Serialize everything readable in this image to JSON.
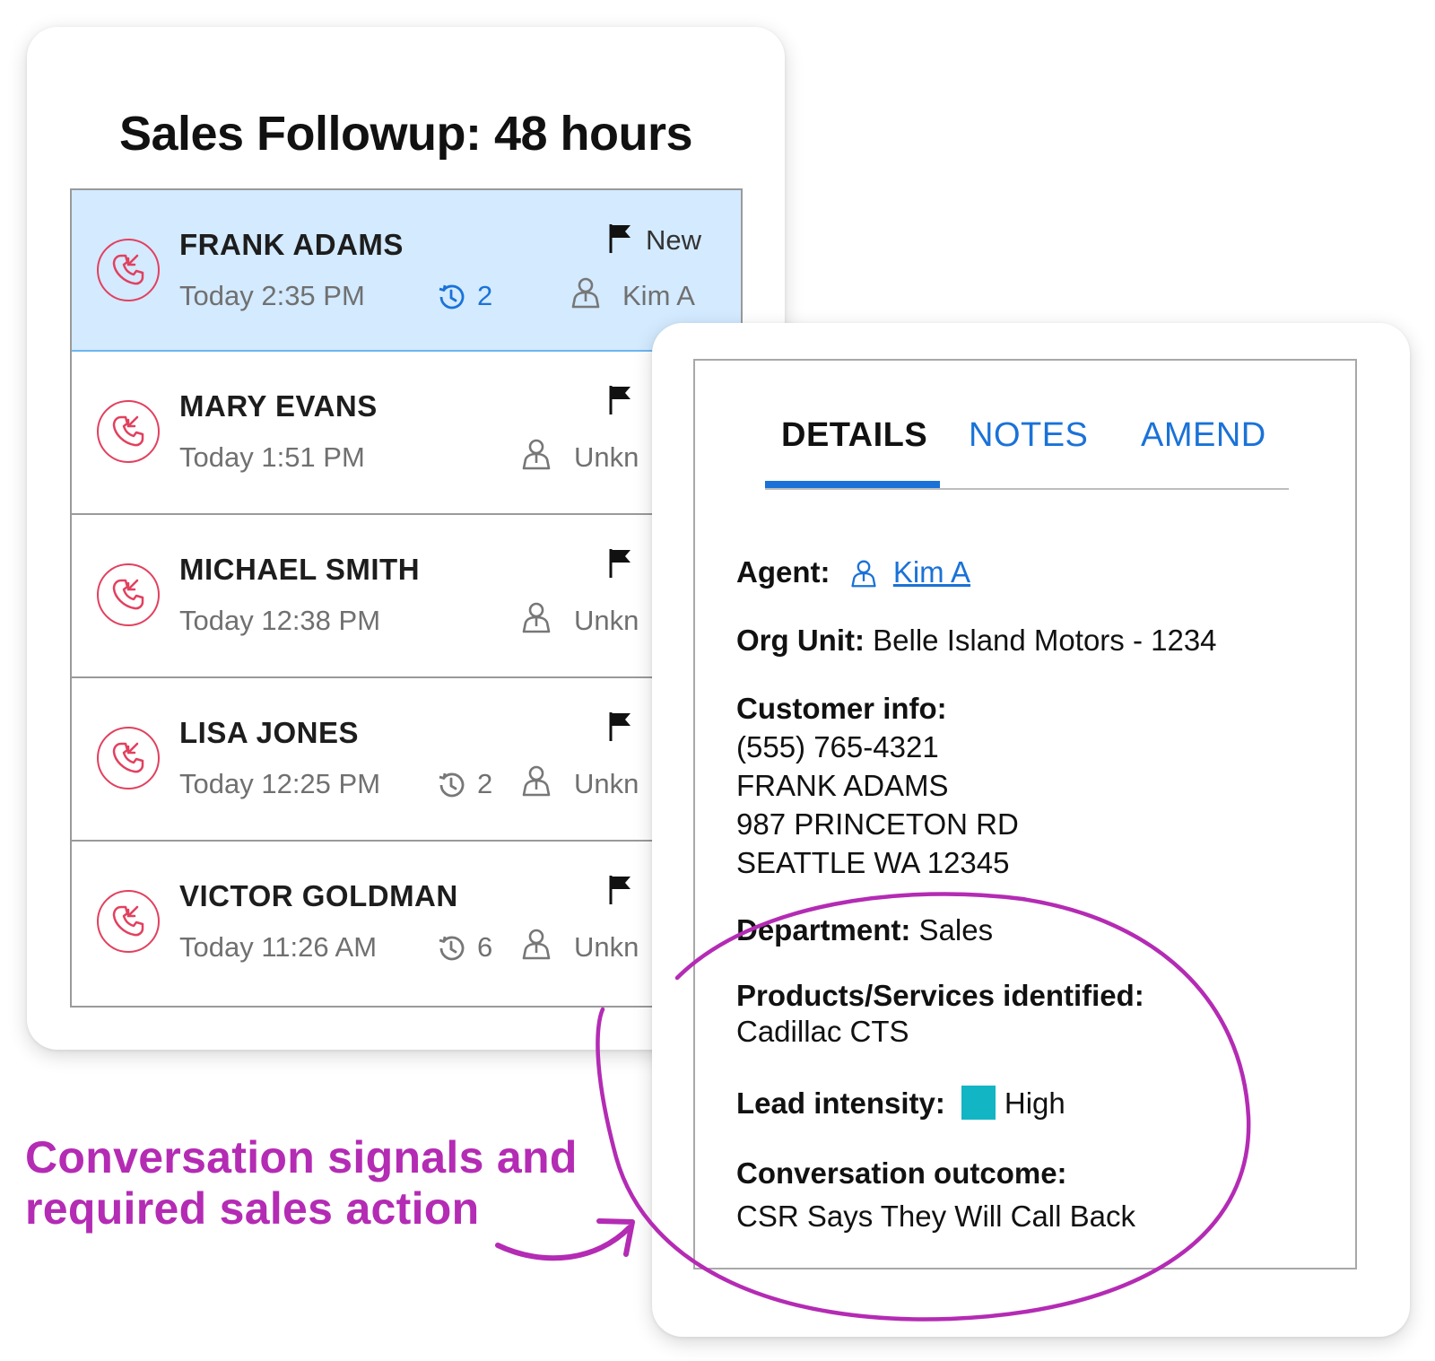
{
  "list": {
    "title": "Sales Followup: 48 hours",
    "rows": [
      {
        "name": "FRANK ADAMS",
        "time": "Today 2:35 PM",
        "status": "New",
        "history": "2",
        "agent": "Kim A"
      },
      {
        "name": "MARY EVANS",
        "time": "Today 1:51 PM",
        "status": "",
        "history": "",
        "agent": "Unkn"
      },
      {
        "name": "MICHAEL SMITH",
        "time": "Today 12:38 PM",
        "status": "",
        "history": "",
        "agent": "Unkn"
      },
      {
        "name": "LISA JONES",
        "time": "Today 12:25 PM",
        "status": "",
        "history": "2",
        "agent": "Unkn"
      },
      {
        "name": "VICTOR GOLDMAN",
        "time": "Today 11:26 AM",
        "status": "",
        "history": "6",
        "agent": "Unkn"
      }
    ]
  },
  "details": {
    "tabs": [
      "DETAILS",
      "NOTES",
      "AMEND"
    ],
    "agent_label": "Agent:",
    "agent_value": "Kim A",
    "org_label": "Org Unit:",
    "org_value": "Belle Island Motors - 1234",
    "customer_label": "Customer info:",
    "customer_lines": [
      "(555) 765-4321",
      "FRANK ADAMS",
      "987 PRINCETON RD",
      "SEATTLE WA 12345"
    ],
    "department_label": "Department:",
    "department_value": "Sales",
    "products_label": "Products/Services identified:",
    "products_value": "Cadillac CTS",
    "lead_label": "Lead intensity:",
    "lead_value": "High",
    "lead_color": "#12b5c3",
    "outcome_label": "Conversation outcome:",
    "outcome_value": "CSR Says They Will Call Back"
  },
  "annotation": {
    "line1": "Conversation signals and",
    "line2": "required sales action",
    "color": "#b42bb4"
  },
  "colors": {
    "accent": "#1a72d8",
    "selected_row": "#d3eaff",
    "call_icon": "#e2405e"
  },
  "icons": [
    "incoming-call-icon",
    "flag-icon",
    "history-icon",
    "agent-icon"
  ]
}
